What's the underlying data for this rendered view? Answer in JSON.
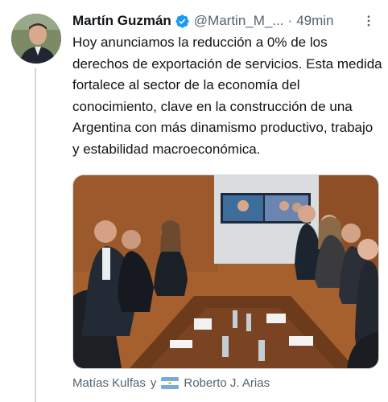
{
  "tweet": {
    "display_name": "Martín Guzmán",
    "verified_icon": "verified-badge-icon",
    "handle": "@Martin_M_...",
    "separator": "·",
    "time": "49min",
    "more_icon": "more-options-icon",
    "text": "Hoy anunciamos la reducción a 0% de los derechos de exportación de servicios. Esta medida fortalece al sector de la economía del conocimiento, clave en la construcción de una Argentina con más dinamismo productivo, trabajo y estabilidad macroeconómica.",
    "tagged_users": [
      "Matías Kulfas",
      "Roberto J. Arias"
    ],
    "tag_separator": "y",
    "flag_icon": "argentina-flag-icon"
  },
  "colors": {
    "verified": "#1d9bf0",
    "secondary_text": "#536471",
    "thread_line": "#cfd9de"
  }
}
